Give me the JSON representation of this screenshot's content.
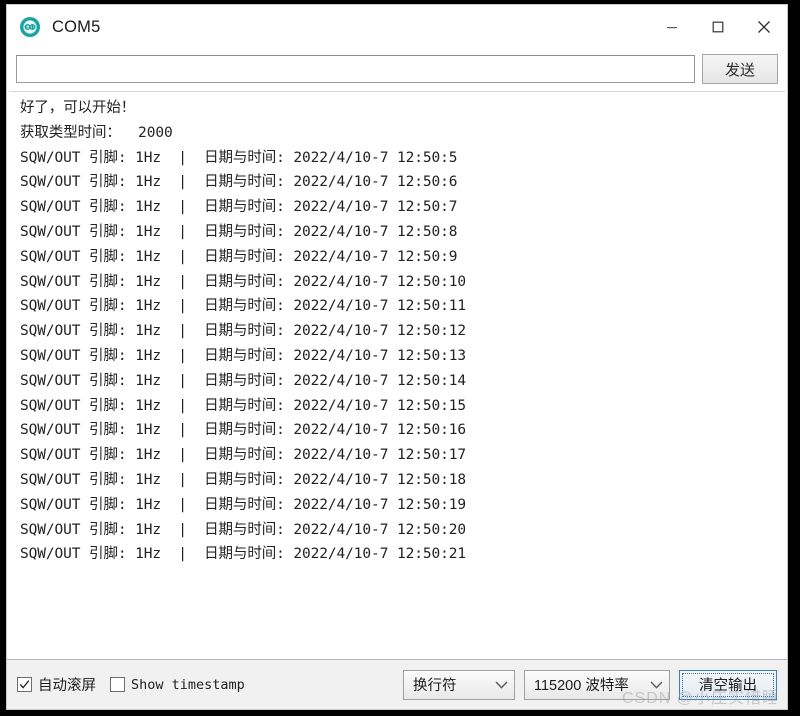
{
  "window": {
    "title": "COM5",
    "app_icon": "arduino-logo-icon",
    "accent_color": "#1aa3a3",
    "controls": {
      "minimize": "minimize-icon",
      "maximize": "maximize-icon",
      "close": "close-icon"
    }
  },
  "send_bar": {
    "input_value": "",
    "input_placeholder": "",
    "send_label": "发送"
  },
  "console": {
    "lines": [
      "好了，可以开始！",
      "获取类型时间：  2000",
      "SQW/OUT 引脚: 1Hz  |  日期与时间: 2022/4/10-7 12:50:5",
      "SQW/OUT 引脚: 1Hz  |  日期与时间: 2022/4/10-7 12:50:6",
      "SQW/OUT 引脚: 1Hz  |  日期与时间: 2022/4/10-7 12:50:7",
      "SQW/OUT 引脚: 1Hz  |  日期与时间: 2022/4/10-7 12:50:8",
      "SQW/OUT 引脚: 1Hz  |  日期与时间: 2022/4/10-7 12:50:9",
      "SQW/OUT 引脚: 1Hz  |  日期与时间: 2022/4/10-7 12:50:10",
      "SQW/OUT 引脚: 1Hz  |  日期与时间: 2022/4/10-7 12:50:11",
      "SQW/OUT 引脚: 1Hz  |  日期与时间: 2022/4/10-7 12:50:12",
      "SQW/OUT 引脚: 1Hz  |  日期与时间: 2022/4/10-7 12:50:13",
      "SQW/OUT 引脚: 1Hz  |  日期与时间: 2022/4/10-7 12:50:14",
      "SQW/OUT 引脚: 1Hz  |  日期与时间: 2022/4/10-7 12:50:15",
      "SQW/OUT 引脚: 1Hz  |  日期与时间: 2022/4/10-7 12:50:16",
      "SQW/OUT 引脚: 1Hz  |  日期与时间: 2022/4/10-7 12:50:17",
      "SQW/OUT 引脚: 1Hz  |  日期与时间: 2022/4/10-7 12:50:18",
      "SQW/OUT 引脚: 1Hz  |  日期与时间: 2022/4/10-7 12:50:19",
      "SQW/OUT 引脚: 1Hz  |  日期与时间: 2022/4/10-7 12:50:20",
      "SQW/OUT 引脚: 1Hz  |  日期与时间: 2022/4/10-7 12:50:21"
    ]
  },
  "bottom_bar": {
    "autoscroll": {
      "label": "自动滚屏",
      "checked": true
    },
    "show_timestamp": {
      "label": "Show timestamp",
      "checked": false
    },
    "line_ending": {
      "value": "换行符",
      "caret": "chevron-down-icon"
    },
    "baud_rate": {
      "value": "115200 波特率",
      "caret": "chevron-down-icon"
    },
    "clear_output_label": "清空输出"
  },
  "watermark": {
    "text": "CSDN @小庄实惜睡"
  }
}
